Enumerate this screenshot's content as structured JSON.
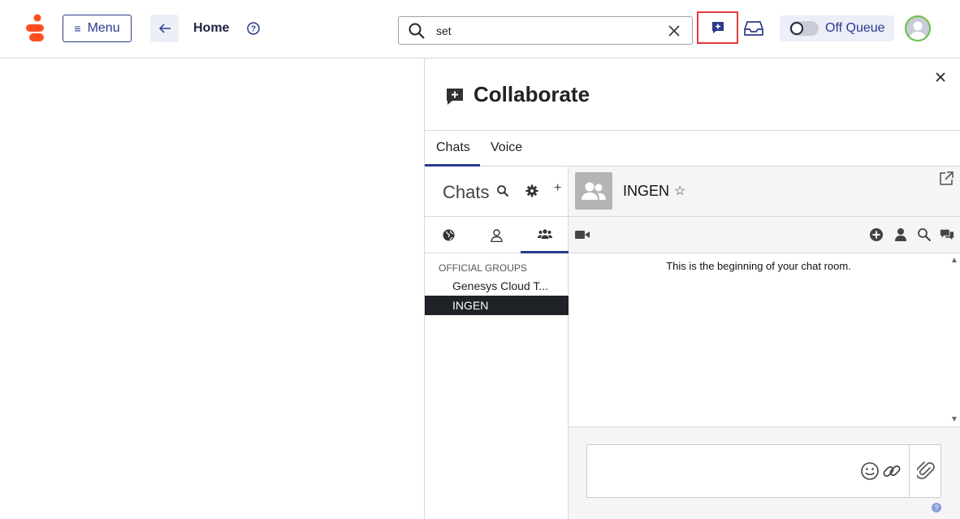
{
  "header": {
    "menu_label": "Menu",
    "home_label": "Home",
    "search": {
      "value": "set",
      "placeholder": ""
    },
    "queue_label": "Off Queue"
  },
  "panel": {
    "title": "Collaborate",
    "tabs": [
      {
        "label": "Chats"
      },
      {
        "label": "Voice"
      }
    ]
  },
  "chat_list": {
    "heading": "Chats",
    "add_symbol": "+",
    "group_label": "OFFICIAL GROUPS",
    "groups": [
      {
        "label": "Genesys Cloud T..."
      },
      {
        "label": "INGEN"
      }
    ]
  },
  "room": {
    "name": "INGEN",
    "star_symbol": "☆",
    "beginning_text": "This is the beginning of your chat room."
  },
  "colors": {
    "brand": "#ff4f1f",
    "accent": "#2a3a8c",
    "highlight_border": "#e03b3b",
    "selected_row": "#1f2227"
  },
  "icons": [
    "genesys-logo",
    "hamburger-icon",
    "back-arrow-icon",
    "help-icon",
    "search-icon",
    "clear-icon",
    "collaborate-icon",
    "inbox-icon",
    "avatar-icon",
    "close-icon",
    "gear-icon",
    "globe-icon",
    "person-icon",
    "group-icon",
    "popout-icon",
    "video-icon",
    "add-circle-icon",
    "user-icon",
    "chat-bubbles-icon",
    "emoji-icon",
    "link-icon",
    "attach-icon"
  ]
}
